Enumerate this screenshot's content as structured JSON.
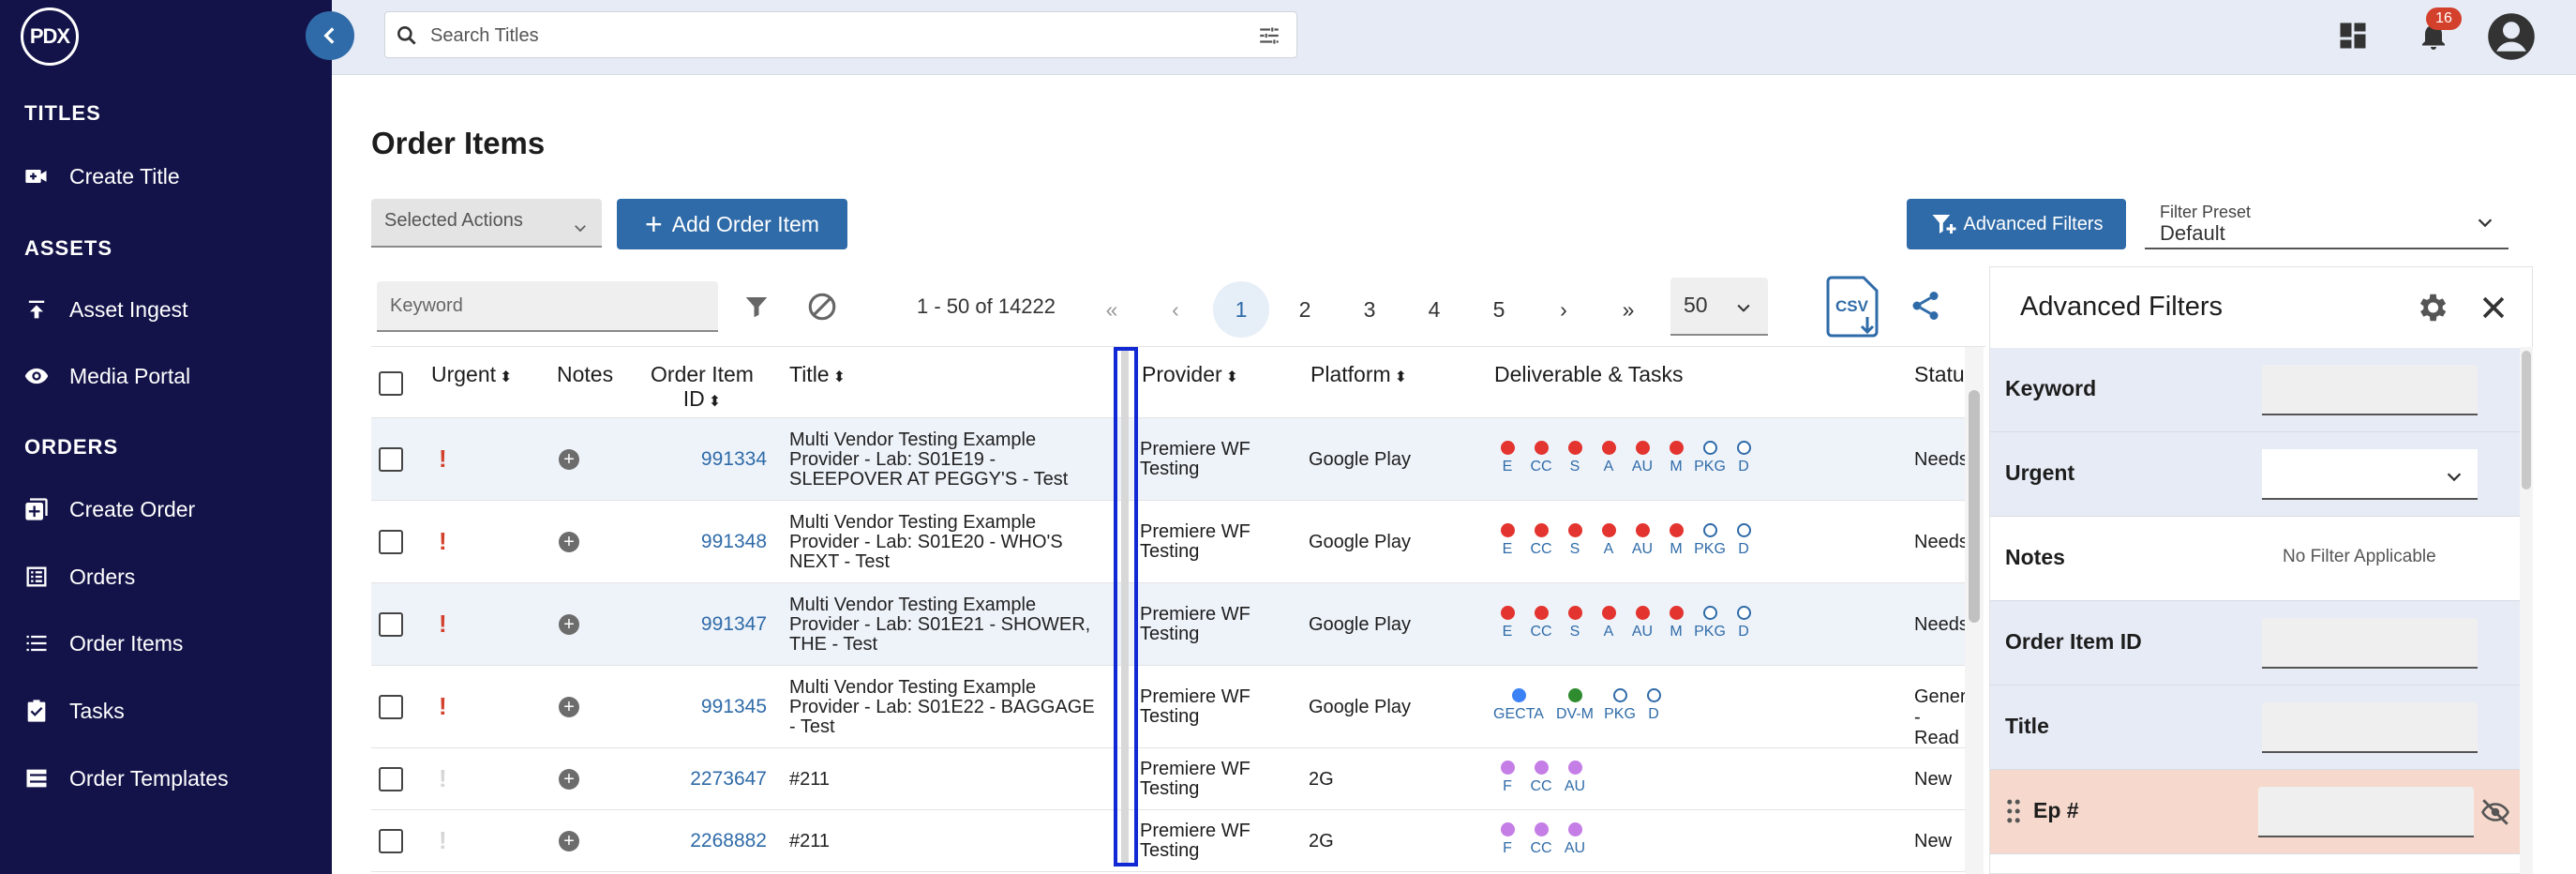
{
  "app": {
    "logo_text": "PDX"
  },
  "sidebar": {
    "sections": [
      {
        "title": "TITLES",
        "items": [
          {
            "label": "Create Title",
            "icon": "video-plus-icon"
          }
        ]
      },
      {
        "title": "ASSETS",
        "items": [
          {
            "label": "Asset Ingest",
            "icon": "upload-icon"
          },
          {
            "label": "Media Portal",
            "icon": "eye-icon"
          }
        ]
      },
      {
        "title": "ORDERS",
        "items": [
          {
            "label": "Create Order",
            "icon": "add-box-icon"
          },
          {
            "label": "Orders",
            "icon": "list-box-icon"
          },
          {
            "label": "Order Items",
            "icon": "list-icon"
          },
          {
            "label": "Tasks",
            "icon": "clipboard-check-icon"
          },
          {
            "label": "Order Templates",
            "icon": "table-rows-icon"
          }
        ]
      }
    ]
  },
  "topbar": {
    "search_placeholder": "Search Titles",
    "notification_count": "16"
  },
  "page": {
    "title": "Order Items",
    "selected_actions_label": "Selected Actions",
    "add_order_item_label": "Add Order Item",
    "advanced_filters_label": "Advanced Filters",
    "filter_preset_caption": "Filter Preset",
    "filter_preset_value": "Default"
  },
  "toolbar": {
    "keyword_placeholder": "Keyword",
    "range_text": "1 - 50 of 14222",
    "first": "«",
    "prev": "‹",
    "next": "›",
    "last": "»",
    "pages": [
      "1",
      "2",
      "3",
      "4",
      "5"
    ],
    "active_page": "1",
    "per_page": "50",
    "csv_label": "CSV"
  },
  "table": {
    "headers": {
      "urgent": "Urgent",
      "notes": "Notes",
      "order_item_id_line1": "Order Item",
      "order_item_id_line2": "ID",
      "title": "Title",
      "provider": "Provider",
      "platform": "Platform",
      "deliverables": "Deliverable & Tasks",
      "status": "Statu"
    },
    "rows": [
      {
        "urgent": true,
        "id": "991334",
        "title_lines": [
          "Multi Vendor Testing Example",
          "Provider - Lab: S01E19 -",
          "SLEEPOVER AT PEGGY'S - Test"
        ],
        "provider_lines": [
          "Premiere WF",
          "Testing"
        ],
        "platform": "Google Play",
        "deliverables": [
          {
            "code": "E",
            "color": "#e3342f",
            "filled": true
          },
          {
            "code": "CC",
            "color": "#e3342f",
            "filled": true
          },
          {
            "code": "S",
            "color": "#e3342f",
            "filled": true
          },
          {
            "code": "A",
            "color": "#e3342f",
            "filled": true
          },
          {
            "code": "AU",
            "color": "#e3342f",
            "filled": true
          },
          {
            "code": "M",
            "color": "#e3342f",
            "filled": true
          },
          {
            "code": "PKG",
            "color": "#2f6ba8",
            "filled": false
          },
          {
            "code": "D",
            "color": "#2f6ba8",
            "filled": false
          }
        ],
        "status_lines": [
          "Needs"
        ]
      },
      {
        "urgent": true,
        "id": "991348",
        "title_lines": [
          "Multi Vendor Testing Example",
          "Provider - Lab: S01E20 - WHO'S",
          "NEXT - Test"
        ],
        "provider_lines": [
          "Premiere WF",
          "Testing"
        ],
        "platform": "Google Play",
        "deliverables": [
          {
            "code": "E",
            "color": "#e3342f",
            "filled": true
          },
          {
            "code": "CC",
            "color": "#e3342f",
            "filled": true
          },
          {
            "code": "S",
            "color": "#e3342f",
            "filled": true
          },
          {
            "code": "A",
            "color": "#e3342f",
            "filled": true
          },
          {
            "code": "AU",
            "color": "#e3342f",
            "filled": true
          },
          {
            "code": "M",
            "color": "#e3342f",
            "filled": true
          },
          {
            "code": "PKG",
            "color": "#2f6ba8",
            "filled": false
          },
          {
            "code": "D",
            "color": "#2f6ba8",
            "filled": false
          }
        ],
        "status_lines": [
          "Needs"
        ]
      },
      {
        "urgent": true,
        "id": "991347",
        "title_lines": [
          "Multi Vendor Testing Example",
          "Provider - Lab: S01E21 - SHOWER,",
          "THE - Test"
        ],
        "provider_lines": [
          "Premiere WF",
          "Testing"
        ],
        "platform": "Google Play",
        "deliverables": [
          {
            "code": "E",
            "color": "#e3342f",
            "filled": true
          },
          {
            "code": "CC",
            "color": "#e3342f",
            "filled": true
          },
          {
            "code": "S",
            "color": "#e3342f",
            "filled": true
          },
          {
            "code": "A",
            "color": "#e3342f",
            "filled": true
          },
          {
            "code": "AU",
            "color": "#e3342f",
            "filled": true
          },
          {
            "code": "M",
            "color": "#e3342f",
            "filled": true
          },
          {
            "code": "PKG",
            "color": "#2f6ba8",
            "filled": false
          },
          {
            "code": "D",
            "color": "#2f6ba8",
            "filled": false
          }
        ],
        "status_lines": [
          "Needs"
        ]
      },
      {
        "urgent": true,
        "id": "991345",
        "title_lines": [
          "Multi Vendor Testing Example",
          "Provider - Lab: S01E22 - BAGGAGE",
          "- Test"
        ],
        "provider_lines": [
          "Premiere WF",
          "Testing"
        ],
        "platform": "Google Play",
        "deliverables": [
          {
            "code": "GECTA",
            "color": "#3b82f6",
            "filled": true
          },
          {
            "code": "DV-M",
            "color": "#2e8b2e",
            "filled": true
          },
          {
            "code": "PKG",
            "color": "#2f6ba8",
            "filled": false
          },
          {
            "code": "D",
            "color": "#2f6ba8",
            "filled": false
          }
        ],
        "status_lines": [
          "Gener",
          "- Read"
        ]
      },
      {
        "urgent": false,
        "id": "2273647",
        "title_lines": [
          "#211"
        ],
        "provider_lines": [
          "Premiere WF",
          "Testing"
        ],
        "platform": "2G",
        "deliverables": [
          {
            "code": "F",
            "color": "#c47ee6",
            "filled": true
          },
          {
            "code": "CC",
            "color": "#c47ee6",
            "filled": true
          },
          {
            "code": "AU",
            "color": "#c47ee6",
            "filled": true
          }
        ],
        "status_lines": [
          "New"
        ]
      },
      {
        "urgent": false,
        "id": "2268882",
        "title_lines": [
          "#211"
        ],
        "provider_lines": [
          "Premiere WF",
          "Testing"
        ],
        "platform": "2G",
        "deliverables": [
          {
            "code": "F",
            "color": "#c47ee6",
            "filled": true
          },
          {
            "code": "CC",
            "color": "#c47ee6",
            "filled": true
          },
          {
            "code": "AU",
            "color": "#c47ee6",
            "filled": true
          }
        ],
        "status_lines": [
          "New"
        ]
      }
    ]
  },
  "advanced_filters": {
    "title": "Advanced Filters",
    "no_filter_text": "No Filter Applicable",
    "fields": [
      {
        "label": "Keyword",
        "type": "input"
      },
      {
        "label": "Urgent",
        "type": "select"
      },
      {
        "label": "Notes",
        "type": "none"
      },
      {
        "label": "Order Item ID",
        "type": "input"
      },
      {
        "label": "Title",
        "type": "input"
      },
      {
        "label": "Ep #",
        "type": "input-hidden"
      }
    ]
  },
  "colors": {
    "sidebar": "#13134a",
    "accent": "#2f6ba8",
    "urgent": "#d3412c",
    "highlight": "#1129d4"
  }
}
